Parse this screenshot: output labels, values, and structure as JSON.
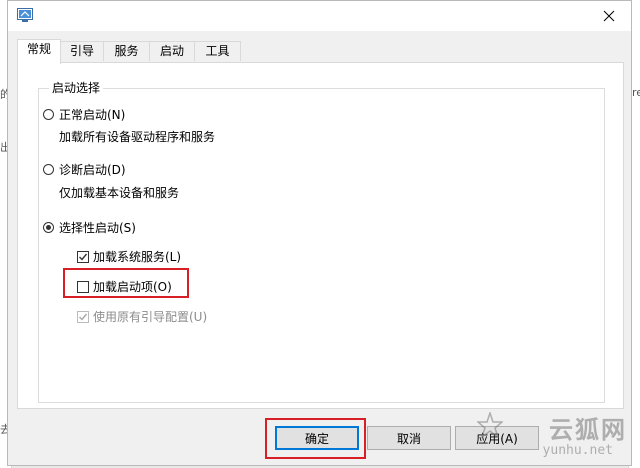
{
  "background": {
    "right_edge_text": "re",
    "left_edge_text_1": "的",
    "left_edge_text_2": "出",
    "left_edge_text_3": "去"
  },
  "tabs": [
    {
      "label": "常规",
      "active": true
    },
    {
      "label": "引导",
      "active": false
    },
    {
      "label": "服务",
      "active": false
    },
    {
      "label": "启动",
      "active": false
    },
    {
      "label": "工具",
      "active": false
    }
  ],
  "startup": {
    "group_title": "启动选择",
    "normal": {
      "label": "正常启动(N)",
      "desc": "加载所有设备驱动程序和服务",
      "checked": false
    },
    "diagnostic": {
      "label": "诊断启动(D)",
      "desc": "仅加载基本设备和服务",
      "checked": false
    },
    "selective": {
      "label": "选择性启动(S)",
      "checked": true
    },
    "options": [
      {
        "label": "加载系统服务(L)",
        "checked": true,
        "enabled": true
      },
      {
        "label": "加载启动项(O)",
        "checked": false,
        "enabled": true
      },
      {
        "label": "使用原有引导配置(U)",
        "checked": true,
        "enabled": false
      }
    ]
  },
  "buttons": {
    "ok": "确定",
    "cancel": "取消",
    "apply": "应用(A)"
  },
  "watermark": {
    "main": "云狐网",
    "sub": "yunhu.net"
  },
  "colors": {
    "highlight": "#d91f26",
    "accent": "#0078d7"
  }
}
